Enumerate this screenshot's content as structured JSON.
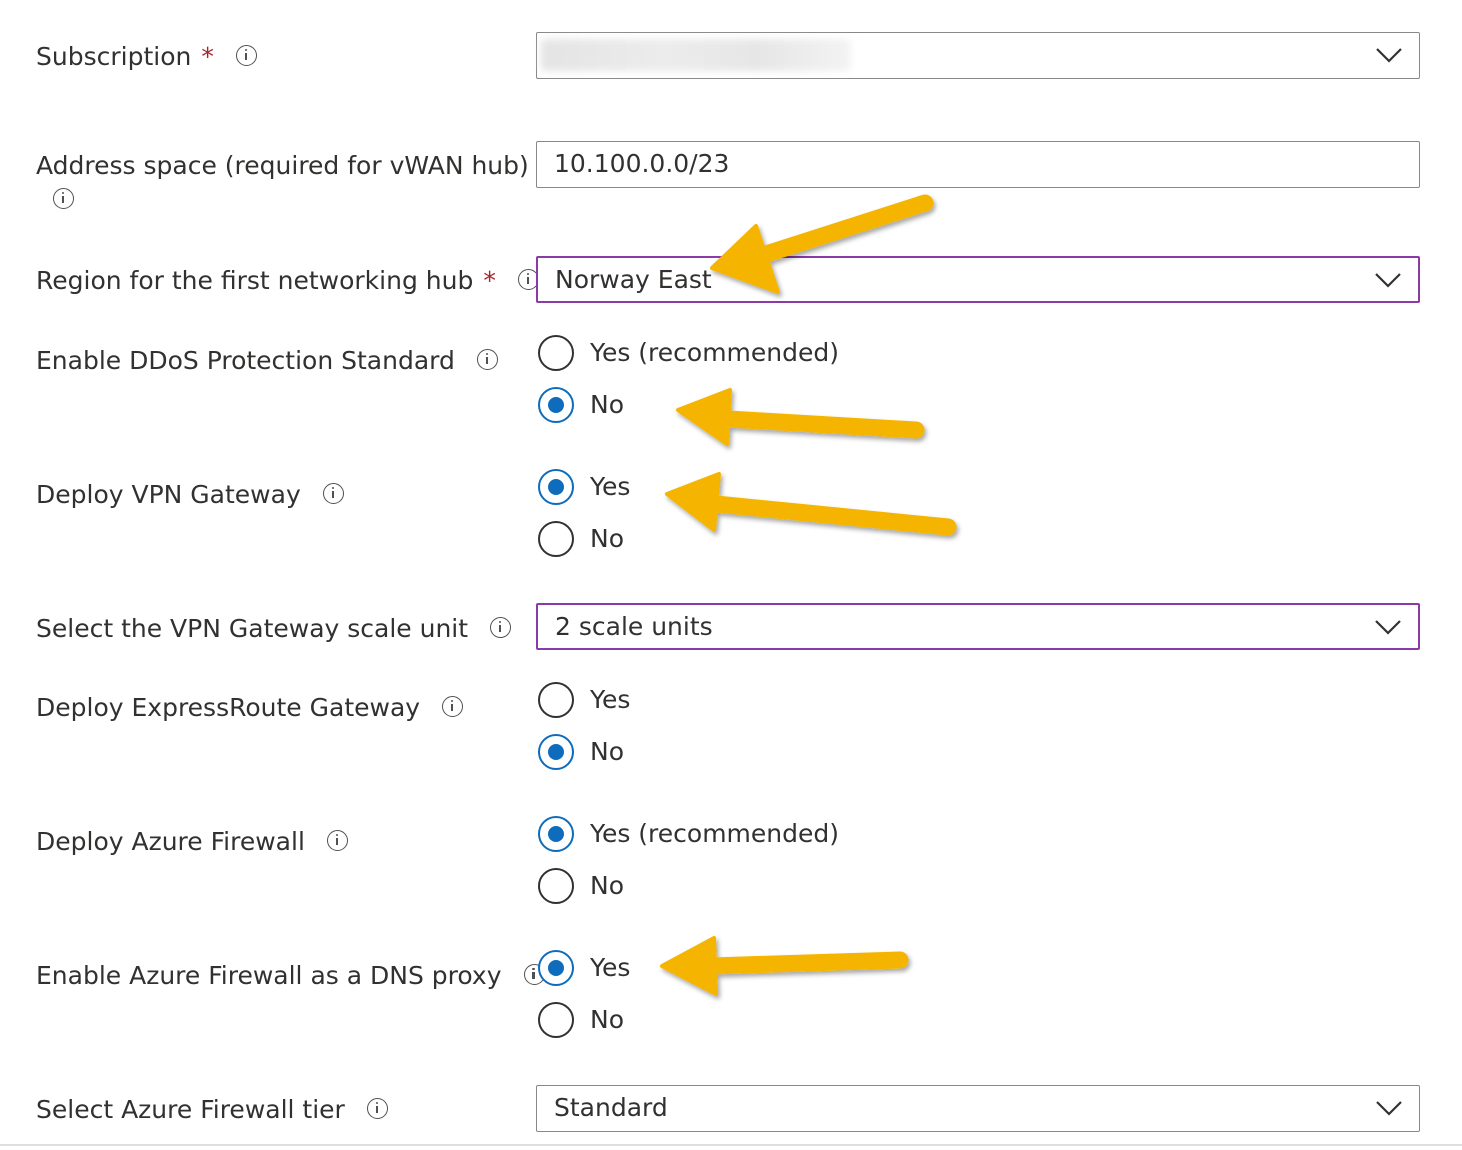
{
  "colors": {
    "required": "#a4262c",
    "focus_border": "#8b3aa6",
    "radio_selected": "#0f6cbd",
    "arrow": "#f5b400"
  },
  "subscription": {
    "label": "Subscription",
    "required": "*",
    "value_blurred": true,
    "icon": "chevron-down-icon"
  },
  "address_space": {
    "label": "Address space (required for vWAN hub)",
    "required": "*",
    "value": "10.100.0.0/23"
  },
  "region": {
    "label": "Region for the first networking hub",
    "required": "*",
    "value": "Norway East",
    "icon": "chevron-down-icon"
  },
  "ddos": {
    "label": "Enable DDoS Protection Standard",
    "options": [
      {
        "label": "Yes (recommended)",
        "selected": false
      },
      {
        "label": "No",
        "selected": true
      }
    ]
  },
  "vpn_gateway": {
    "label": "Deploy VPN Gateway",
    "options": [
      {
        "label": "Yes",
        "selected": true
      },
      {
        "label": "No",
        "selected": false
      }
    ]
  },
  "vpn_scale": {
    "label": "Select the VPN Gateway scale unit",
    "value": "2 scale units",
    "icon": "chevron-down-icon"
  },
  "expressroute": {
    "label": "Deploy ExpressRoute Gateway",
    "options": [
      {
        "label": "Yes",
        "selected": false
      },
      {
        "label": "No",
        "selected": true
      }
    ]
  },
  "firewall": {
    "label": "Deploy Azure Firewall",
    "options": [
      {
        "label": "Yes (recommended)",
        "selected": true
      },
      {
        "label": "No",
        "selected": false
      }
    ]
  },
  "dns_proxy": {
    "label": "Enable Azure Firewall as a DNS proxy",
    "options": [
      {
        "label": "Yes",
        "selected": true
      },
      {
        "label": "No",
        "selected": false
      }
    ]
  },
  "firewall_tier": {
    "label": "Select Azure Firewall tier",
    "value": "Standard",
    "icon": "chevron-down-icon"
  },
  "annotations": {
    "arrow_icon": "yellow-arrow-icon",
    "count": 4
  }
}
